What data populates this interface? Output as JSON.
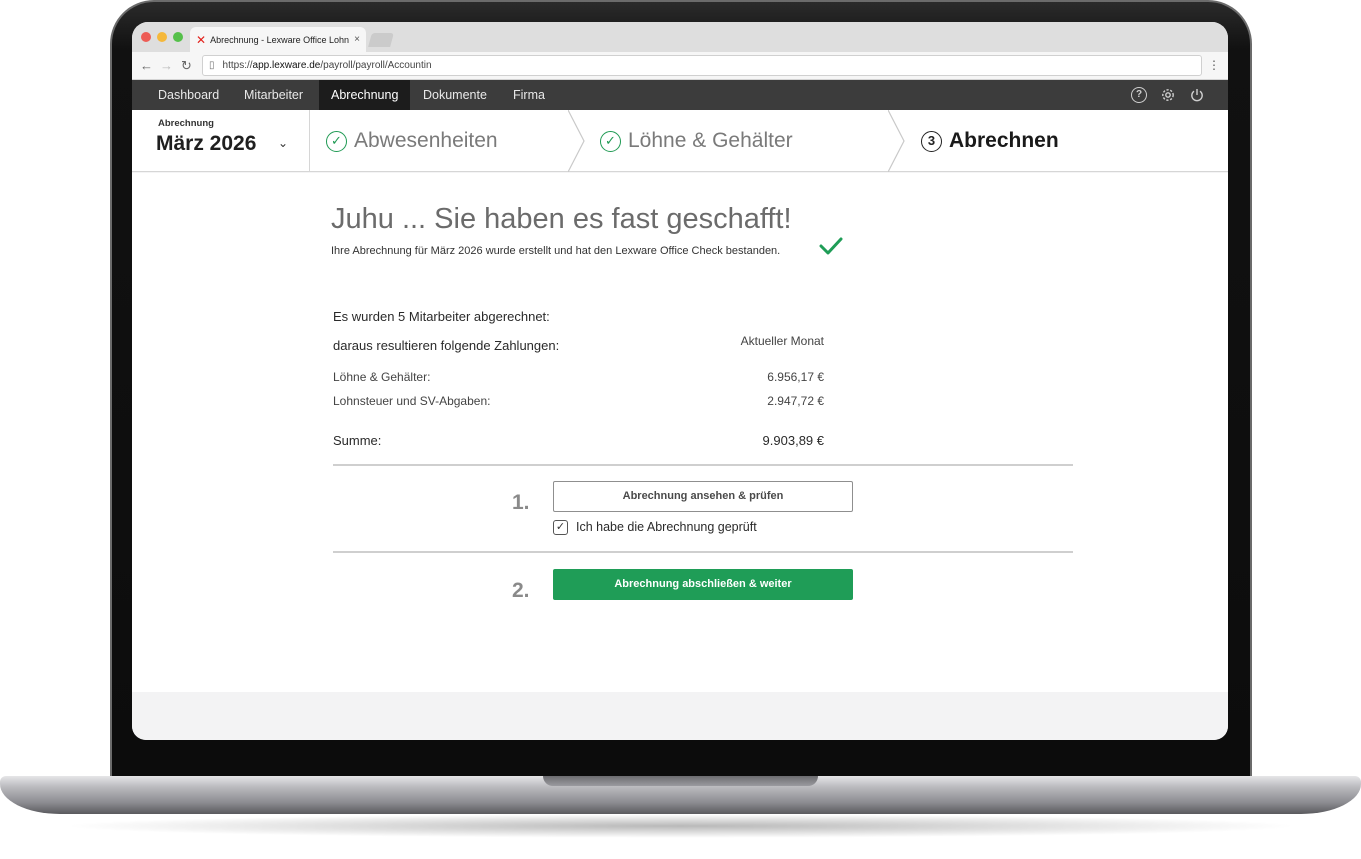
{
  "browser": {
    "tab_title": "Abrechnung - Lexware Office Lohn",
    "tab_close": "×",
    "url_protocol": "https://",
    "url_host": "app.lexware.de",
    "url_path": "/payroll/payroll/Accountin"
  },
  "appnav": {
    "items": [
      "Dashboard",
      "Mitarbeiter",
      "Abrechnung",
      "Dokumente",
      "Firma"
    ],
    "active": "Abrechnung",
    "icons": [
      "help-icon",
      "gear-icon",
      "power-icon"
    ]
  },
  "period": {
    "label": "Abrechnung",
    "value": "März 2026"
  },
  "steps": [
    {
      "label": "Abwesenheiten",
      "state": "done"
    },
    {
      "label": "Löhne & Gehälter",
      "state": "done"
    },
    {
      "label": "Abrechnen",
      "number": "3",
      "state": "current"
    }
  ],
  "main": {
    "headline": "Juhu ... Sie haben es fast geschafft!",
    "subline": "Ihre Abrechnung für März 2026 wurde erstellt und hat den Lexware Office Check bestanden.",
    "employees_line": "Es wurden 5 Mitarbeiter abgerechnet:",
    "payments_line": "daraus resultieren folgende Zahlungen:",
    "column_header": "Aktueller Monat",
    "rows": [
      {
        "label": "Löhne & Gehälter:",
        "value": "6.956,17 €"
      },
      {
        "label": "Lohnsteuer und SV-Abgaben:",
        "value": "2.947,72 €"
      }
    ],
    "sum_label": "Summe:",
    "sum_value": "9.903,89 €",
    "step1_no": "1.",
    "review_button": "Abrechnung ansehen & prüfen",
    "checkbox_label": "Ich habe die Abrechnung geprüft",
    "checkbox_checked": true,
    "step2_no": "2.",
    "finish_button": "Abrechnung abschließen & weiter"
  },
  "colors": {
    "accent_green": "#1f9d57",
    "nav_bg": "#3c3c3c",
    "nav_active_bg": "#1c1c1c"
  }
}
